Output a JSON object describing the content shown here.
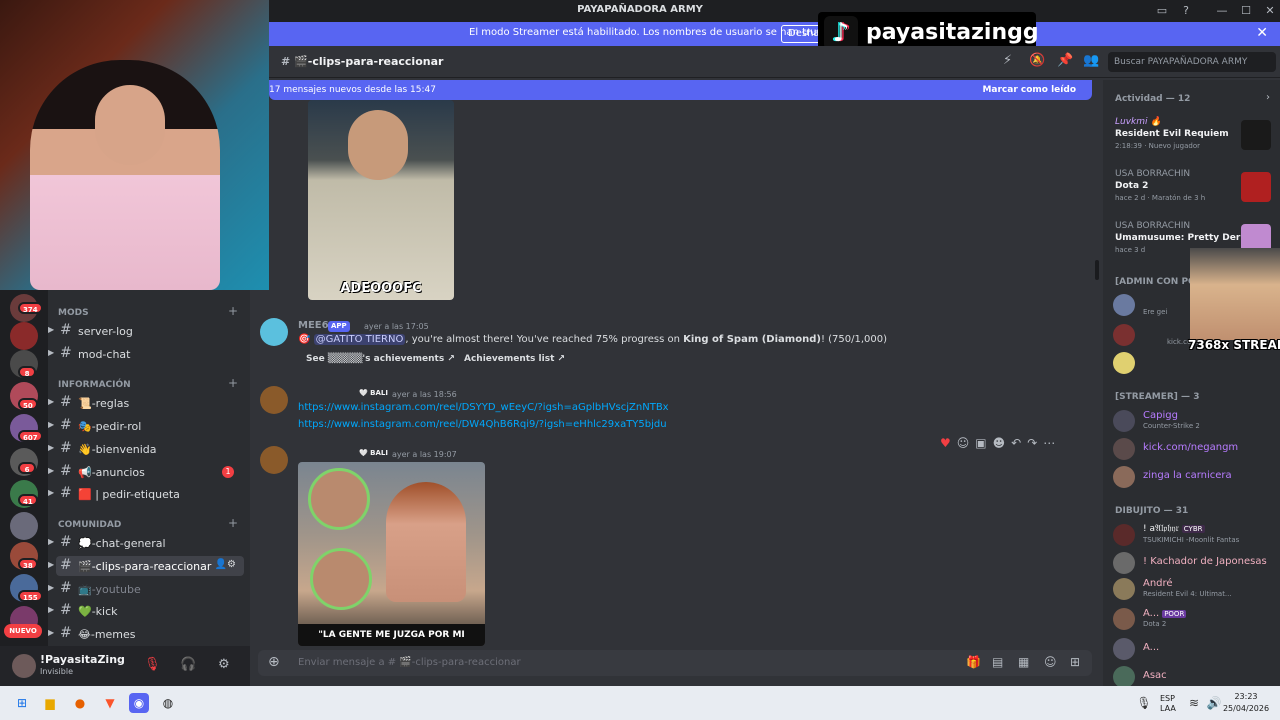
{
  "window": {
    "title": "PAYAPAÑADORA ARMY"
  },
  "streamer_banner": {
    "text": "El modo Streamer está habilitado. Los nombres de usuario se han truncado.",
    "button": "Deshab"
  },
  "overlay": {
    "tiktok_name": "payasitazingg",
    "meme_text": "7368x STREAM"
  },
  "servers": {
    "badges": [
      "374",
      "8",
      "50",
      "607",
      "6",
      "41",
      "38",
      "155"
    ],
    "new_label": "NUEVO"
  },
  "channels": {
    "categories": {
      "mods": "MODS",
      "info": "INFORMACIÓN",
      "community": "COMUNIDAD"
    },
    "items": [
      {
        "label": "server-log"
      },
      {
        "label": "mod-chat"
      },
      {
        "label": "📜-reglas"
      },
      {
        "label": "🎭-pedir-rol"
      },
      {
        "label": "👋-bienvenida"
      },
      {
        "label": "📢-anuncios",
        "unread": "1"
      },
      {
        "label": "🟥 | pedir-etiqueta"
      },
      {
        "label": "💭-chat-general"
      },
      {
        "label": "🎬-clips-para-reaccionar"
      },
      {
        "label": "📺-youtube"
      },
      {
        "label": "💚-kick"
      },
      {
        "label": "😂-memes"
      }
    ]
  },
  "user": {
    "name": "!PayasitaZing",
    "status": "Invisible"
  },
  "header": {
    "channel": "🎬-clips-para-reaccionar",
    "search_placeholder": "Buscar PAYAPAÑADORA ARMY"
  },
  "new_messages": {
    "text": "17 mensajes nuevos desde las 15:47",
    "mark": "Marcar como leído"
  },
  "messages": {
    "img1_caption": "ADEOOOFC",
    "mee6": {
      "name": "MEE6",
      "tag": "APP",
      "time": "ayer a las 17:05",
      "mention": "@GATITO TIERNO",
      "text_pre": ", you're almost there! You've reached 75% progress on ",
      "bold": "King of Spam (Diamond)",
      "text_post": "! (750/1,000)",
      "btn1": "See ▒▒▒▒▒'s achievements",
      "btn2": "Achievements list"
    },
    "bali1": {
      "tag": "BALI",
      "time": "ayer a las 18:56",
      "link1": "https://www.instagram.com/reel/DSYYD_wEeyC/?igsh=aGplbHVscjZnNTBx",
      "link2": "https://www.instagram.com/reel/DW4QhB6Rqi9/?igsh=eHhlc29xaTY5bjdu"
    },
    "bali2": {
      "tag": "BALI",
      "time": "ayer a las 19:07",
      "caption": "\"LA GENTE ME JUZGA POR MI PASADO"
    }
  },
  "composer": {
    "placeholder": "Enviar mensaje a # 🎬-clips-para-reaccionar"
  },
  "members": {
    "activity_header": "Actividad — 12",
    "activities": [
      {
        "user": "Luvkmi 🔥",
        "game": "Resident Evil Requiem",
        "sub": "2:18:39 · Nuevo jugador"
      },
      {
        "user": "USA BORRACHIN",
        "game": "Dota 2",
        "sub": "hace 2 d · Maratón de 3 h"
      },
      {
        "user": "USA BORRACHIN",
        "game": "Umamusume: Pretty Derby",
        "sub": "hace 3 d"
      }
    ],
    "admin_header": "[ADMIN CON PODE",
    "admin_sub1": "Ere gei",
    "admin_sub2": "kick.com",
    "streamer_header": "[STREAMER] — 3",
    "streamers": [
      {
        "name": "Capigg",
        "sub": "Counter-Strike 2"
      },
      {
        "name": "kick.com/negangm",
        "sub": ""
      },
      {
        "name": "zinga la carnicera",
        "sub": ""
      }
    ],
    "dibujito_header": "DIBUJITO — 31",
    "dibujito": [
      {
        "name": "! a𝔄𝔩𝔭𝔥𝔶𝔯",
        "badge": "CYBR",
        "sub": "TSUKIMICHI -Moonlit Fantas"
      },
      {
        "name": "! Kachador de Japonesas",
        "badge": "",
        "sub": ""
      },
      {
        "name": "André",
        "badge": "",
        "sub": "Resident Evil 4: Ultimat..."
      },
      {
        "name": "A...",
        "badge": "POOR",
        "sub": "Dota 2"
      },
      {
        "name": "A...",
        "badge": "",
        "sub": ""
      },
      {
        "name": "Asac",
        "badge": "",
        "sub": ""
      }
    ]
  },
  "taskbar": {
    "lang1": "ESP",
    "lang2": "LAA",
    "time": "23:23",
    "date": "25/04/2026"
  }
}
